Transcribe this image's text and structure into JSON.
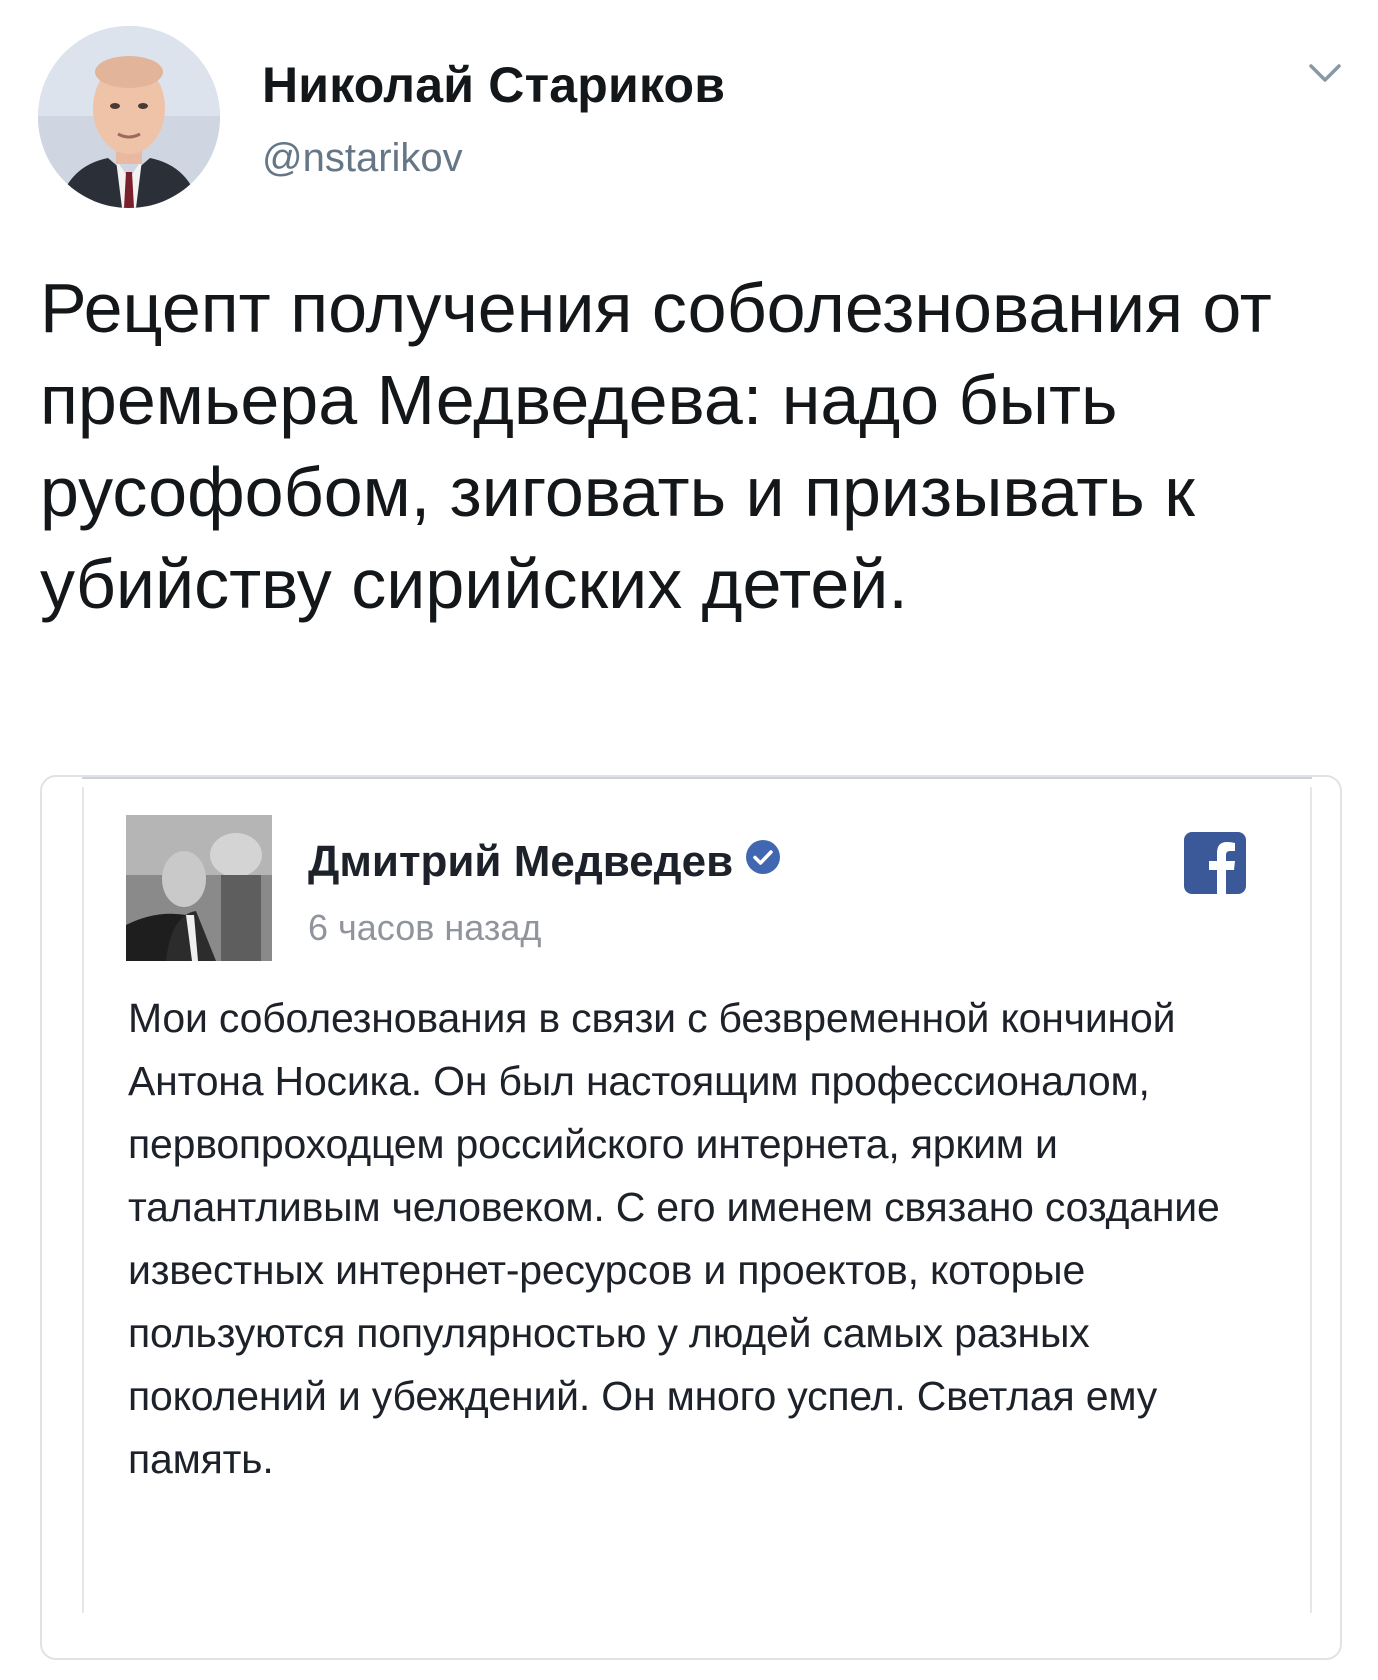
{
  "tweet": {
    "author_name": "Николай Стариков",
    "author_handle": "@nstarikov",
    "text": "Рецепт получения соболезнования от премьера Медведева: надо быть русофобом, зиговать и призывать к убийству сирийских детей.",
    "menu_icon": "chevron-down-icon"
  },
  "quoted_post": {
    "platform_icon": "facebook-icon",
    "author_name": "Дмитрий Медведев",
    "verified_icon": "verified-badge-icon",
    "time": "6 часов назад",
    "text": "Мои соболезнования в связи с безвременной кончиной Антона Носика. Он был настоящим профессионалом, первопроходцем российского интернета, ярким и талантливым человеком. С его именем связано создание известных интернет-ресурсов и проектов, которые пользуются популярностью у людей самых разных поколений и убеждений. Он много успел. Светлая ему память."
  },
  "colors": {
    "name_text": "#14171a",
    "handle_text": "#657786",
    "fb_blue": "#3b5998",
    "verified_blue": "#4267b2",
    "card_border": "#dfe3e8"
  }
}
